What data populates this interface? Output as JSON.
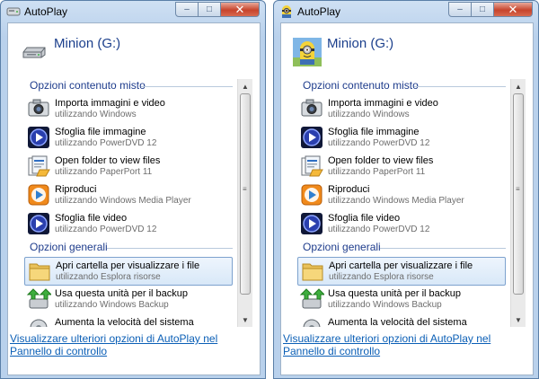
{
  "dialogs": [
    {
      "title": "AutoPlay",
      "drive_name": "Minion (G:)",
      "drive_icon": "usb-drive-icon",
      "section_media": "Opzioni contenuto misto",
      "section_general": "Opzioni generali",
      "items": [
        {
          "label": "Importa immagini e video",
          "sub": "utilizzando Windows",
          "icon": "camera-icon"
        },
        {
          "label": "Sfoglia file immagine",
          "sub": "utilizzando PowerDVD 12",
          "icon": "powerdvd-icon"
        },
        {
          "label": "Open folder to view files",
          "sub": "utilizzando PaperPort 11",
          "icon": "paperport-icon"
        },
        {
          "label": "Riproduci",
          "sub": "utilizzando Windows Media Player",
          "icon": "media-player-icon"
        },
        {
          "label": "Sfoglia file video",
          "sub": "utilizzando PowerDVD 12",
          "icon": "powerdvd-icon"
        }
      ],
      "general_items": [
        {
          "label": "Apri cartella per visualizzare i file",
          "sub": "utilizzando Esplora risorse",
          "icon": "folder-icon",
          "selected": true
        },
        {
          "label": "Usa questa unità per il backup",
          "sub": "utilizzando Windows Backup",
          "icon": "backup-icon"
        },
        {
          "label": "Aumenta la velocità del sistema",
          "sub": "",
          "icon": "readyboost-icon"
        }
      ],
      "footer_link": "Visualizzare ulteriori opzioni di AutoPlay nel Pannello di controllo"
    },
    {
      "title": "AutoPlay",
      "drive_name": "Minion (G:)",
      "drive_icon": "minion-icon",
      "section_media": "Opzioni contenuto misto",
      "section_general": "Opzioni generali",
      "items": [
        {
          "label": "Importa immagini e video",
          "sub": "utilizzando Windows",
          "icon": "camera-icon"
        },
        {
          "label": "Sfoglia file immagine",
          "sub": "utilizzando PowerDVD 12",
          "icon": "powerdvd-icon"
        },
        {
          "label": "Open folder to view files",
          "sub": "utilizzando PaperPort 11",
          "icon": "paperport-icon"
        },
        {
          "label": "Riproduci",
          "sub": "utilizzando Windows Media Player",
          "icon": "media-player-icon"
        },
        {
          "label": "Sfoglia file video",
          "sub": "utilizzando PowerDVD 12",
          "icon": "powerdvd-icon"
        }
      ],
      "general_items": [
        {
          "label": "Apri cartella per visualizzare i file",
          "sub": "utilizzando Esplora risorse",
          "icon": "folder-icon",
          "selected": true
        },
        {
          "label": "Usa questa unità per il backup",
          "sub": "utilizzando Windows Backup",
          "icon": "backup-icon"
        },
        {
          "label": "Aumenta la velocità del sistema",
          "sub": "",
          "icon": "readyboost-icon"
        }
      ],
      "footer_link": "Visualizzare ulteriori opzioni di AutoPlay nel Pannello di controllo"
    }
  ],
  "window_controls": {
    "minimize": "–",
    "maximize": "□",
    "close": "✕"
  },
  "scrollbar": {
    "up": "▲",
    "down": "▼",
    "grip": "≡"
  },
  "colors": {
    "link": "#0b5fb6",
    "section": "#1e3c8c",
    "drive_name": "#1b3f8c",
    "close": "#c7442c"
  }
}
